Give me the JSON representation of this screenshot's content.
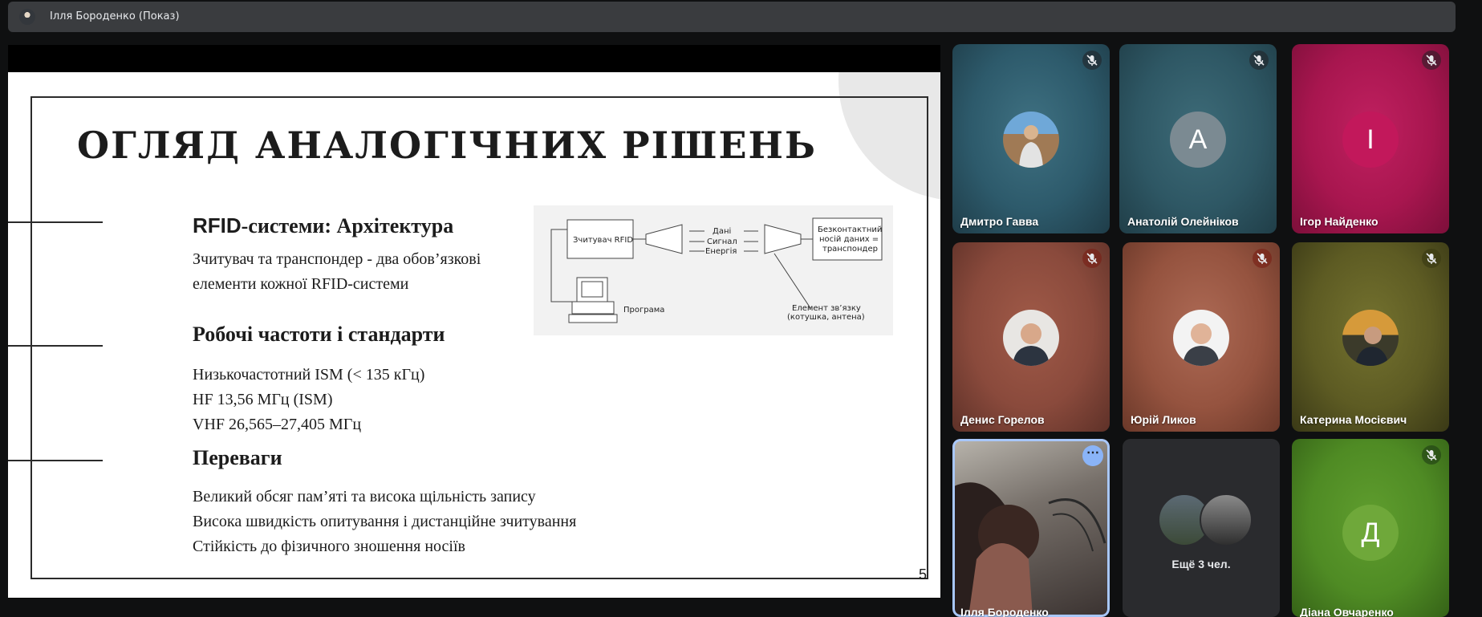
{
  "presenter": {
    "title": "Ілля Бороденко (Показ)"
  },
  "slide": {
    "title": "ОГЛЯД АНАЛОГІЧНИХ РІШЕНЬ",
    "page_number": "5",
    "section1": {
      "heading_rfid": "RFID",
      "heading_rest": "-системи:  Архітектура",
      "lines": [
        "Зчитувач та транспондер - два обов’язкові",
        "елементи кожної RFID-системи"
      ]
    },
    "section2": {
      "heading": "Робочі частоти і стандарти",
      "lines": [
        "Низькочастотний ISM (< 135 кГц)",
        "HF 13,56 МГц (ISM)",
        "VHF 26,565–27,405 МГц"
      ]
    },
    "section3": {
      "heading": "Переваги",
      "lines": [
        "Великий обсяг пам’яті та висока щільність запису",
        "Висока швидкість опитування і дистанційне зчитування",
        "Стійкість до фізичного зношення носіїв"
      ]
    },
    "diagram": {
      "reader": "Зчитувач RFID",
      "data": "Дані",
      "signal": "Сигнал",
      "energy": "Енергія",
      "carrier": [
        "Безконтактний",
        "носій даних =",
        "транспондер"
      ],
      "program": "Програма",
      "coupling": [
        "Елемент зв’язку",
        "(котушка, антена)"
      ]
    }
  },
  "participants": [
    {
      "name": "Дмитро Гавва",
      "muted": true,
      "avatar": "photo"
    },
    {
      "name": "Анатолій Олейніков",
      "muted": true,
      "initial": "А",
      "avatar_color": "#7b8a92"
    },
    {
      "name": "Ігор Найденко",
      "muted": true,
      "initial": "І",
      "avatar_color": "#c2185b"
    },
    {
      "name": "Денис Горелов",
      "muted": true,
      "avatar": "photo"
    },
    {
      "name": "Юрій Ликов",
      "muted": true,
      "avatar": "photo"
    },
    {
      "name": "Катерина Мосієвич",
      "muted": true,
      "avatar": "photo"
    },
    {
      "name": "Ілля Бороденко",
      "muted": false,
      "video": true
    },
    {
      "more_label": "Ещё 3 чел."
    },
    {
      "name": "Діана Овчаренко",
      "muted": true,
      "initial": "Д",
      "avatar_color": "#6fa83a"
    }
  ],
  "colors": {
    "tile1": "#2d5a6b",
    "tile2": "#2e5764",
    "tile3": "#a8164f",
    "tile4": "#8a4a3c",
    "tile5": "#95533f",
    "tile6": "#5d5b23",
    "tile8": "#2a2b2e",
    "tile9": "#4f8b24"
  }
}
